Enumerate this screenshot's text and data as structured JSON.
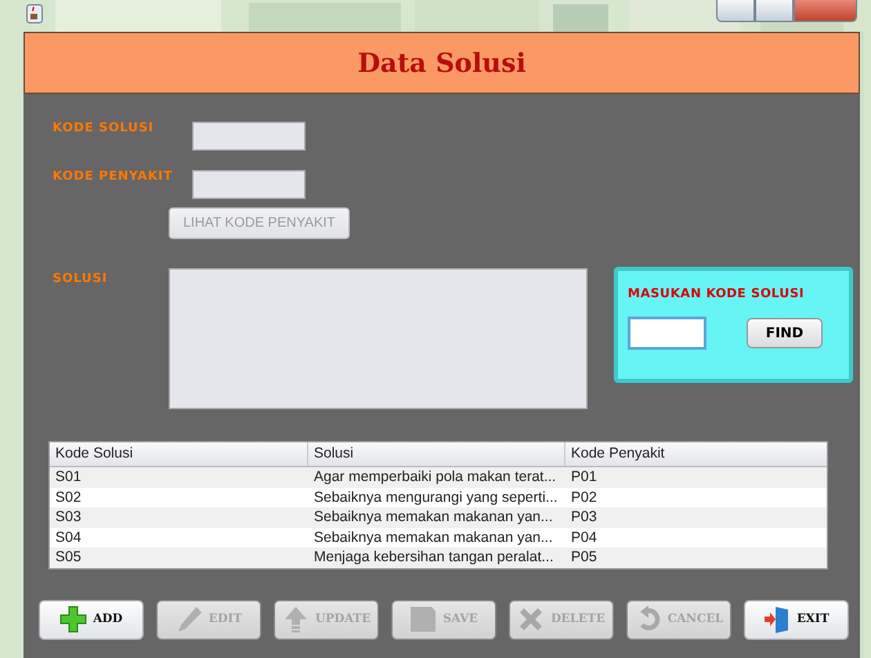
{
  "window": {
    "title": "Data Solusi"
  },
  "form": {
    "fields": [
      {
        "label": "KODE SOLUSI"
      },
      {
        "label": "KODE PENYAKIT"
      }
    ],
    "lookup_button": {
      "label": "LIHAT KODE PENYAKIT",
      "disabled": true
    },
    "solusi": {
      "label": "SOLUSI"
    }
  },
  "search_panel": {
    "title": "MASUKAN KODE SOLUSI",
    "button": "FIND"
  },
  "table": {
    "columns": [
      "Kode Solusi",
      "Solusi",
      "Kode Penyakit"
    ],
    "rows": [
      [
        "S01",
        "Agar memperbaiki pola makan terat...",
        "P01"
      ],
      [
        "S02",
        "Sebaiknya mengurangi yang seperti...",
        "P02"
      ],
      [
        "S03",
        "Sebaiknya memakan makanan yan...",
        "P03"
      ],
      [
        "S04",
        "Sebaiknya memakan makanan yan...",
        "P04"
      ],
      [
        "S05",
        "Menjaga kebersihan tangan peralat...",
        "P05"
      ]
    ]
  },
  "buttons": [
    {
      "kind": "add",
      "label": "ADD",
      "disabled": false
    },
    {
      "kind": "edit",
      "label": "EDIT",
      "disabled": true
    },
    {
      "kind": "update",
      "label": "UPDATE",
      "disabled": true
    },
    {
      "kind": "save",
      "label": "SAVE",
      "disabled": true
    },
    {
      "kind": "delete",
      "label": "DELETE",
      "disabled": true
    },
    {
      "kind": "cancel",
      "label": "CANCEL",
      "disabled": true
    },
    {
      "kind": "exit",
      "label": "EXIT",
      "disabled": false
    }
  ]
}
